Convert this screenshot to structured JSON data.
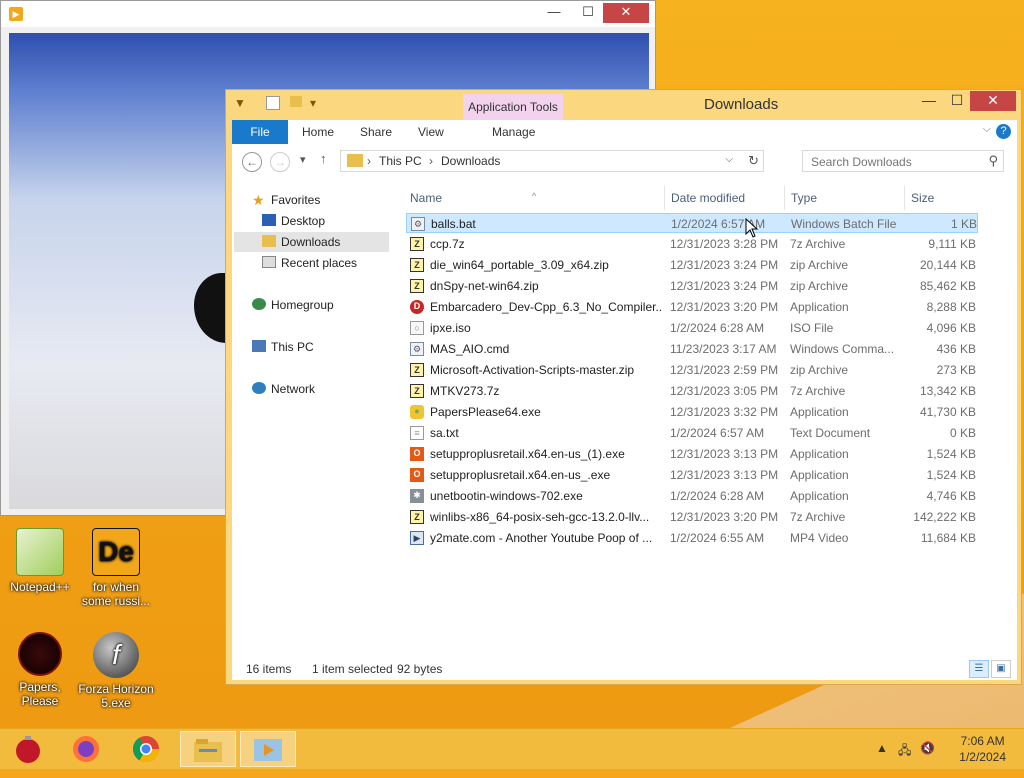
{
  "player": {
    "close_glyph": "✕",
    "minimize_glyph": "—",
    "maximize_glyph": "☐"
  },
  "explorer": {
    "title": "Downloads",
    "context_tab": "Application Tools",
    "ribbon_tabs": [
      "File",
      "Home",
      "Share",
      "View",
      "Manage"
    ],
    "breadcrumb": [
      "This PC",
      "Downloads"
    ],
    "search_placeholder": "Search Downloads",
    "nav": {
      "favorites": "Favorites",
      "desktop": "Desktop",
      "downloads": "Downloads",
      "recent": "Recent places",
      "homegroup": "Homegroup",
      "thispc": "This PC",
      "network": "Network"
    },
    "columns": {
      "name": "Name",
      "date": "Date modified",
      "type": "Type",
      "size": "Size"
    },
    "files": [
      {
        "name": "balls.bat",
        "date": "1/2/2024 6:57 AM",
        "type": "Windows Batch File",
        "size": "1 KB",
        "icon": "batch-file-icon"
      },
      {
        "name": "ccp.7z",
        "date": "12/31/2023 3:28 PM",
        "type": "7z Archive",
        "size": "9,111 KB",
        "icon": "archive-icon"
      },
      {
        "name": "die_win64_portable_3.09_x64.zip",
        "date": "12/31/2023 3:24 PM",
        "type": "zip Archive",
        "size": "20,144 KB",
        "icon": "archive-icon"
      },
      {
        "name": "dnSpy-net-win64.zip",
        "date": "12/31/2023 3:24 PM",
        "type": "zip Archive",
        "size": "85,462 KB",
        "icon": "archive-icon"
      },
      {
        "name": "Embarcadero_Dev-Cpp_6.3_No_Compiler...",
        "date": "12/31/2023 3:20 PM",
        "type": "Application",
        "size": "8,288 KB",
        "icon": "devcpp-icon"
      },
      {
        "name": "ipxe.iso",
        "date": "1/2/2024 6:28 AM",
        "type": "ISO File",
        "size": "4,096 KB",
        "icon": "disc-image-icon"
      },
      {
        "name": "MAS_AIO.cmd",
        "date": "11/23/2023 3:17 AM",
        "type": "Windows Comma...",
        "size": "436 KB",
        "icon": "batch-file-icon"
      },
      {
        "name": "Microsoft-Activation-Scripts-master.zip",
        "date": "12/31/2023 2:59 PM",
        "type": "zip Archive",
        "size": "273 KB",
        "icon": "archive-icon"
      },
      {
        "name": "MTKV273.7z",
        "date": "12/31/2023 3:05 PM",
        "type": "7z Archive",
        "size": "13,342 KB",
        "icon": "archive-icon"
      },
      {
        "name": "PapersPlease64.exe",
        "date": "12/31/2023 3:32 PM",
        "type": "Application",
        "size": "41,730 KB",
        "icon": "game-icon"
      },
      {
        "name": "sa.txt",
        "date": "1/2/2024 6:57 AM",
        "type": "Text Document",
        "size": "0 KB",
        "icon": "text-file-icon"
      },
      {
        "name": "setupproplusretail.x64.en-us_(1).exe",
        "date": "12/31/2023 3:13 PM",
        "type": "Application",
        "size": "1,524 KB",
        "icon": "office-icon"
      },
      {
        "name": "setupproplusretail.x64.en-us_.exe",
        "date": "12/31/2023 3:13 PM",
        "type": "Application",
        "size": "1,524 KB",
        "icon": "office-icon"
      },
      {
        "name": "unetbootin-windows-702.exe",
        "date": "1/2/2024 6:28 AM",
        "type": "Application",
        "size": "4,746 KB",
        "icon": "unetbootin-icon"
      },
      {
        "name": "winlibs-x86_64-posix-seh-gcc-13.2.0-llv...",
        "date": "12/31/2023 3:20 PM",
        "type": "7z Archive",
        "size": "142,222 KB",
        "icon": "archive-icon"
      },
      {
        "name": "y2mate.com - Another Youtube Poop of ...",
        "date": "1/2/2024 6:55 AM",
        "type": "MP4 Video",
        "size": "11,684 KB",
        "icon": "video-file-icon"
      }
    ],
    "status": {
      "items": "16 items",
      "selected": "1 item selected",
      "size": "92 bytes"
    }
  },
  "desktop_icons": {
    "notepad": "Notepad++",
    "forwhen_line1": "for when",
    "forwhen_line2": "some russi...",
    "papers": "Papers, Please",
    "forza_line1": "Forza Horizon",
    "forza_line2": "5.exe"
  },
  "taskbar": {
    "time": "7:06 AM",
    "date": "1/2/2024"
  }
}
